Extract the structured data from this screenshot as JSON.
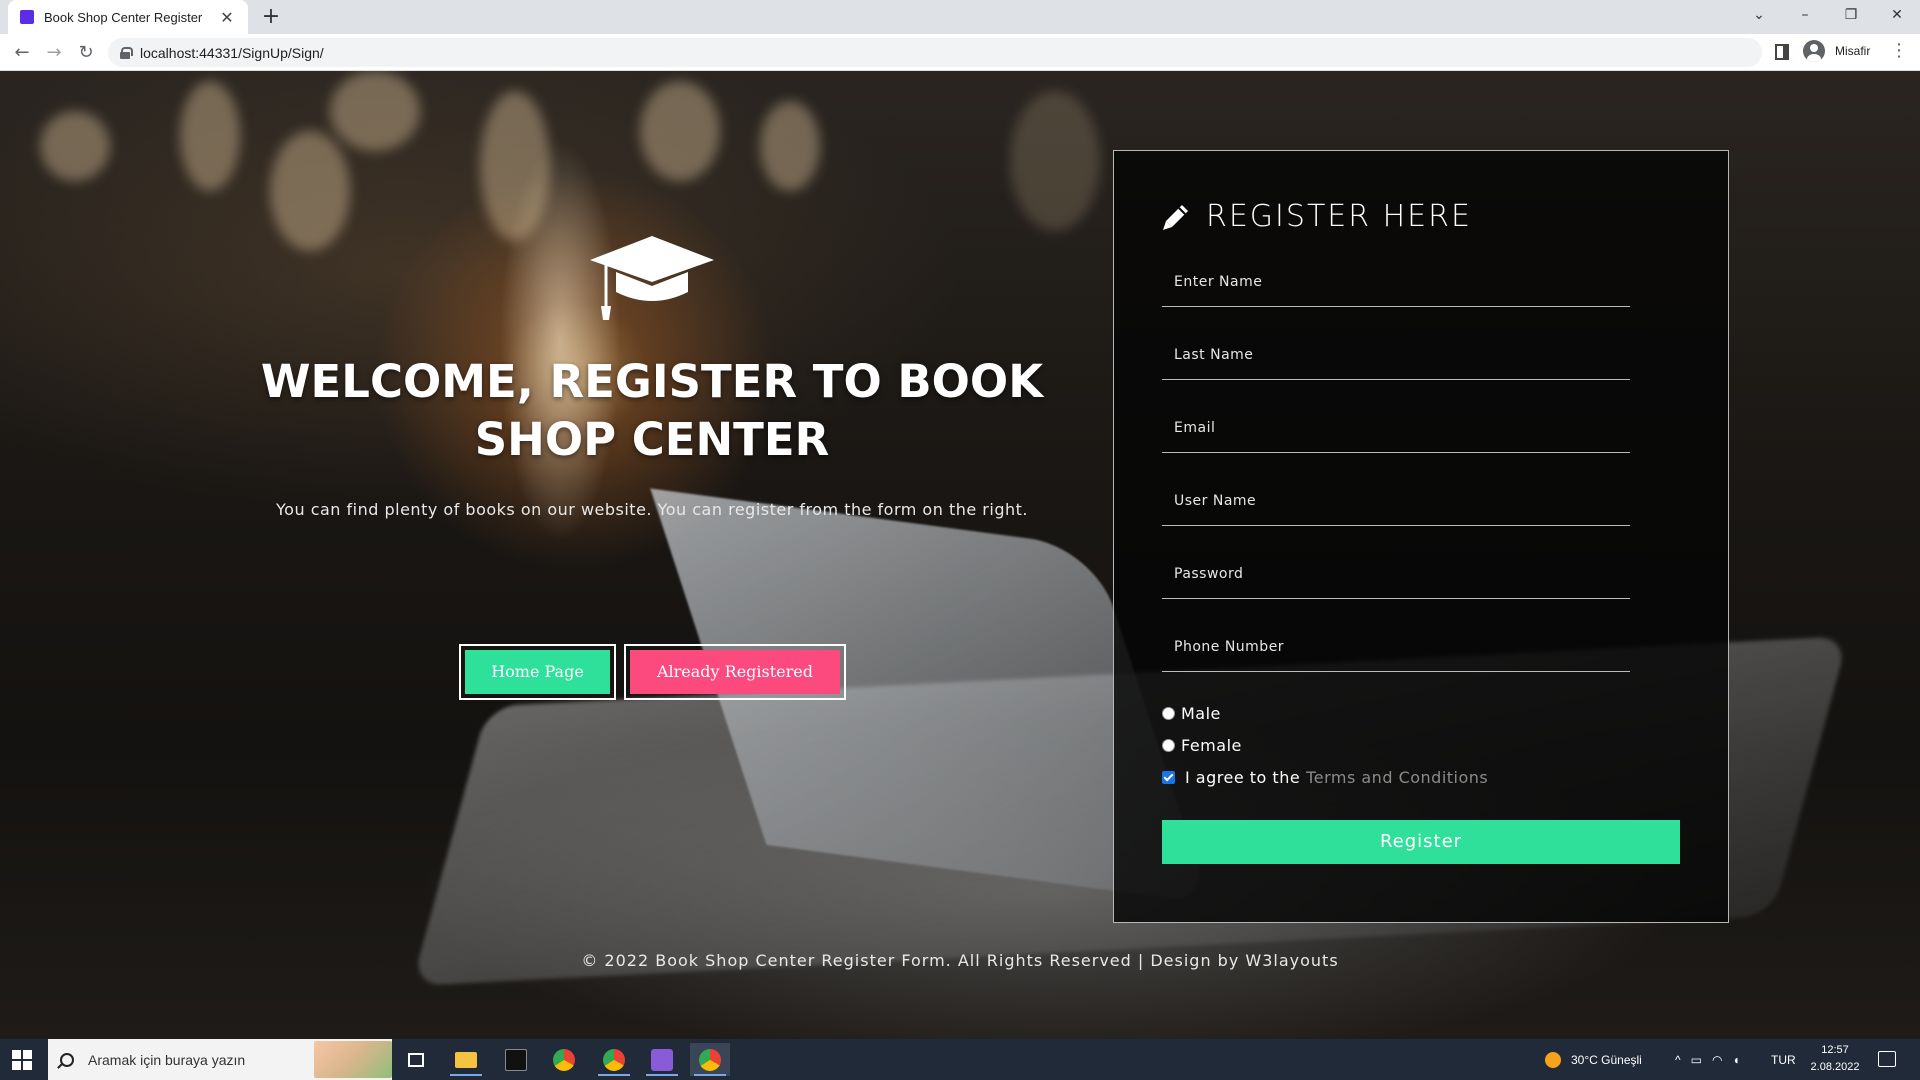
{
  "browser": {
    "tab_title": "Book Shop Center Register",
    "tab_close": "✕",
    "new_tab": "+",
    "url": "localhost:44331/SignUp/Sign/",
    "profile_name": "Misafir",
    "window_controls": [
      "⌄",
      "–",
      "❐",
      "✕"
    ]
  },
  "hero": {
    "title": "WELCOME, REGISTER TO BOOK SHOP CENTER",
    "subtitle": "You can find plenty of books on our website. You can register from the form on the right.",
    "home_button": "Home Page",
    "already_button": "Already Registered"
  },
  "form": {
    "title": "REGISTER HERE",
    "fields": {
      "first_name": "Enter Name",
      "last_name": "Last Name",
      "email": "Email",
      "username": "User Name",
      "password": "Password",
      "phone": "Phone Number"
    },
    "gender_male": "Male",
    "gender_female": "Female",
    "agree_text": "I agree to the",
    "terms_link": "Terms and Conditions",
    "terms_checked": true,
    "submit": "Register"
  },
  "footer": "© 2022 Book Shop Center Register Form. All Rights Reserved | Design by W3layouts",
  "taskbar": {
    "search_placeholder": "Aramak için buraya yazın",
    "weather": "30°C  Güneşli",
    "language": "TUR",
    "time": "12:57",
    "date": "2.08.2022"
  },
  "colors": {
    "accent_green": "#2fe09a",
    "accent_pink": "#fc4a7e",
    "terms_gray": "#8a8a8a"
  }
}
